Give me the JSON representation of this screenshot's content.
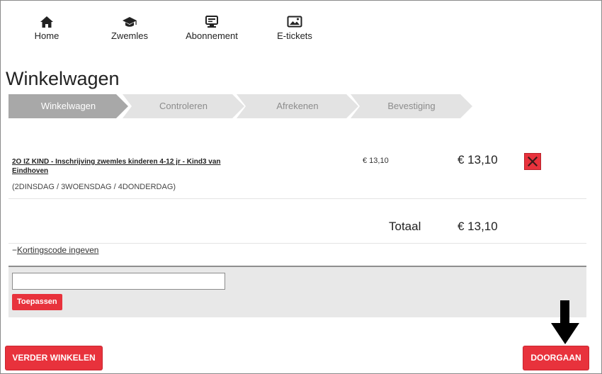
{
  "nav": [
    {
      "label": "Home",
      "icon": "home-icon"
    },
    {
      "label": "Zwemles",
      "icon": "graduation-cap-icon"
    },
    {
      "label": "Abonnement",
      "icon": "card-terminal-icon"
    },
    {
      "label": "E-tickets",
      "icon": "image-ticket-icon"
    }
  ],
  "page": {
    "title": "Winkelwagen"
  },
  "steps": [
    {
      "label": "Winkelwagen",
      "active": true
    },
    {
      "label": "Controleren",
      "active": false
    },
    {
      "label": "Afrekenen",
      "active": false
    },
    {
      "label": "Bevestiging",
      "active": false
    }
  ],
  "cart": {
    "items": [
      {
        "name": "2O IZ KIND - Inschrijving zwemles kinderen 4-12 jr - Kind3 van Eindhoven",
        "variant": "(2DINSDAG / 3WOENSDAG / 4DONDERDAG)",
        "unit_price": "€ 13,10",
        "line_price": "€ 13,10"
      }
    ],
    "total_label": "Totaal",
    "total_value": "€ 13,10"
  },
  "discount": {
    "toggle_symbol": "−",
    "toggle_label": "Kortingscode ingeven",
    "input_value": "",
    "input_placeholder": "",
    "apply_label": "Toepassen"
  },
  "actions": {
    "continue_shopping": "VERDER WINKELEN",
    "proceed": "DOORGAAN"
  },
  "colors": {
    "accent": "#e8323c",
    "step_active": "#a8a8a8",
    "step_inactive": "#e3e3e3"
  }
}
